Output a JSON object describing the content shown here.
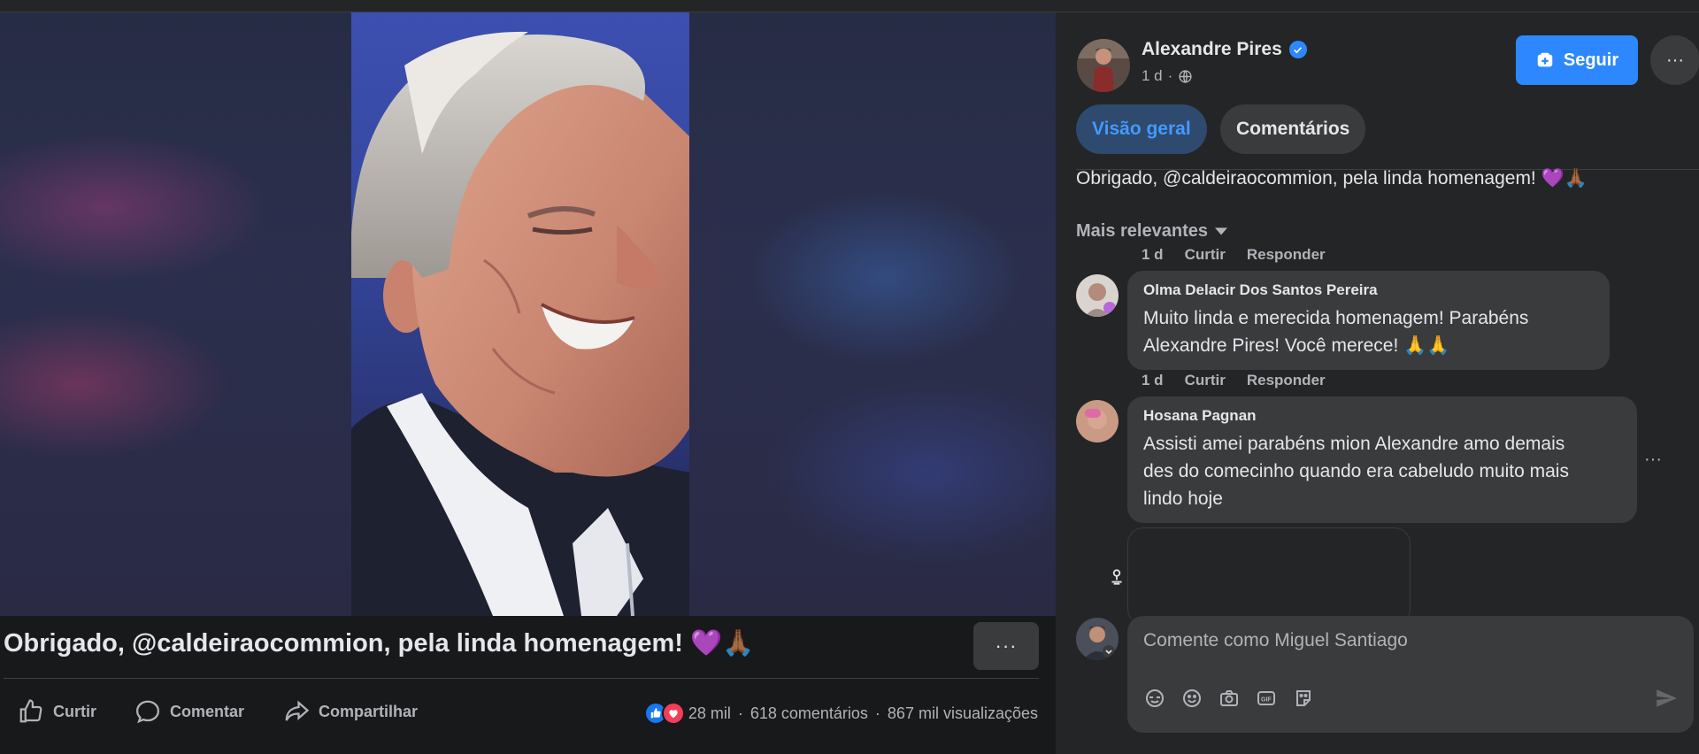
{
  "post": {
    "caption": "Obrigado, @caldeiraocommion, pela linda homenagem! 💜🙏🏾",
    "more_label": "···"
  },
  "actions": {
    "like_label": "Curtir",
    "comment_label": "Comentar",
    "share_label": "Compartilhar"
  },
  "stats": {
    "reactions": "28 mil",
    "comments": "618 comentários",
    "views": "867 mil visualizações",
    "separator": "·"
  },
  "author": {
    "name": "Alexandre Pires",
    "time": "1 d",
    "dot": "·",
    "follow_label": "Seguir",
    "more_label": "···"
  },
  "tabs": [
    {
      "label": "Visão geral",
      "active": true
    },
    {
      "label": "Comentários",
      "active": false
    }
  ],
  "post_text": "Obrigado, @caldeiraocommion, pela linda homenagem! 💜🙏🏾",
  "sort_label": "Mais relevantes",
  "comments": [
    {
      "meta": {
        "time": "1 d",
        "like": "Curtir",
        "reply": "Responder"
      }
    },
    {
      "name": "Olma Delacir Dos Santos Pereira",
      "text_lines": [
        "Muito linda e merecida homenagem! Parabéns",
        "Alexandre Pires! Você merece! 🙏🙏"
      ],
      "meta": {
        "time": "1 d",
        "like": "Curtir",
        "reply": "Responder"
      }
    },
    {
      "name": "Hosana Pagnan",
      "text_lines": [
        "Assisti amei parabéns mion Alexandre amo demais",
        "des do comecinho quando era cabeludo muito mais",
        "lindo hoje"
      ]
    }
  ],
  "comment_more_label": "···",
  "composer": {
    "placeholder": "Comente como Miguel Santiago",
    "icons": [
      "sticker-icon",
      "emoji-icon",
      "camera-icon",
      "gif-icon",
      "avatar-sticker-icon"
    ]
  },
  "colors": {
    "accent": "#2d88ff",
    "background": "#18191a",
    "panel": "#242526",
    "bubble": "#3a3b3c"
  }
}
